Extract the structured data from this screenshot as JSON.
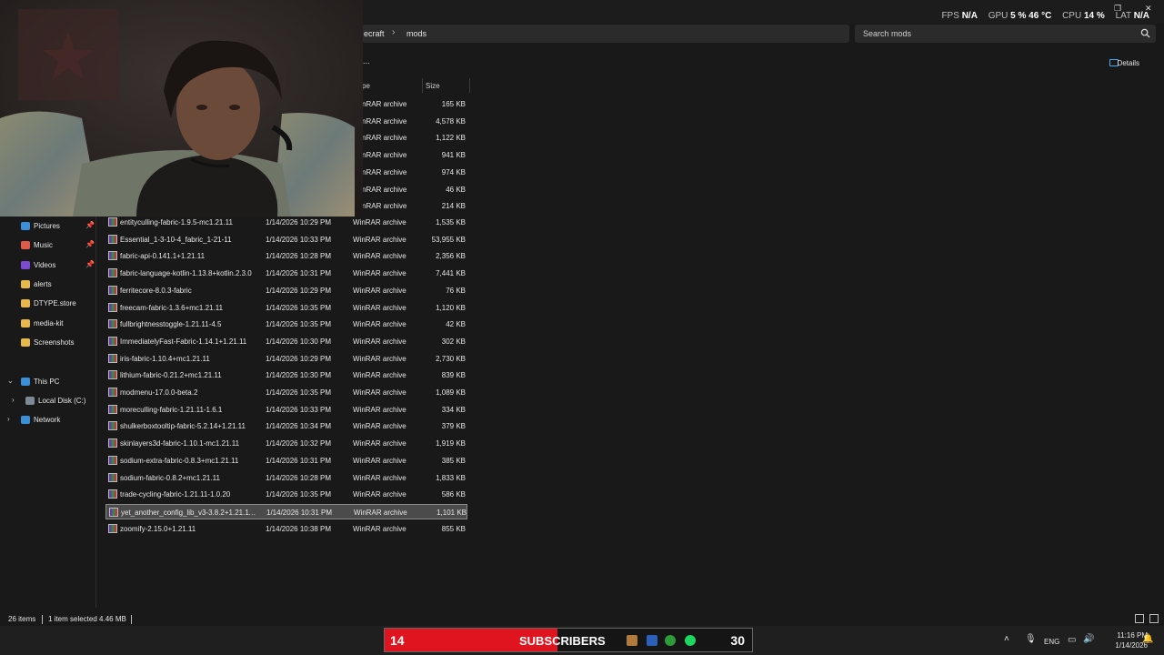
{
  "overlay": {
    "fps_label": "FPS",
    "fps_value": "N/A",
    "gpu_label": "GPU",
    "gpu_value": "5 %  46 °C",
    "cpu_label": "CPU",
    "cpu_value": "14 %",
    "lat_label": "LAT",
    "lat_value": "N/A"
  },
  "breadcrumb": {
    "parent": "ecraft",
    "current": "mods"
  },
  "search": {
    "placeholder": "Search mods"
  },
  "toolbar": {
    "details_label": "Details",
    "more_label": "..."
  },
  "columns": {
    "type": "pe",
    "size": "Size"
  },
  "nav": {
    "quick_access": [
      {
        "label": "Pictures",
        "icon": "pictures-icon",
        "color": "#3b8fd8",
        "pinned": true
      },
      {
        "label": "Music",
        "icon": "music-icon",
        "color": "#e05a4a",
        "pinned": true
      },
      {
        "label": "Videos",
        "icon": "videos-icon",
        "color": "#7a4bd0",
        "pinned": true
      },
      {
        "label": "alerts",
        "icon": "folder-icon",
        "color": "#e8b84a",
        "pinned": false
      },
      {
        "label": "DTYPE.store",
        "icon": "folder-icon",
        "color": "#e8b84a",
        "pinned": false
      },
      {
        "label": "media-kit",
        "icon": "folder-icon",
        "color": "#e8b84a",
        "pinned": false
      },
      {
        "label": "Screenshots",
        "icon": "folder-icon",
        "color": "#e8b84a",
        "pinned": false
      }
    ],
    "this_pc": "This PC",
    "local_disk": "Local Disk (C:)",
    "network": "Network"
  },
  "partial_rows": [
    {
      "type": "nRAR archive",
      "size": "165 KB"
    },
    {
      "type": "nRAR archive",
      "size": "4,578 KB"
    },
    {
      "type": "nRAR archive",
      "size": "1,122 KB"
    },
    {
      "type": "nRAR archive",
      "size": "941 KB"
    },
    {
      "type": "nRAR archive",
      "size": "974 KB"
    },
    {
      "type": "nRAR archive",
      "size": "46 KB"
    },
    {
      "type": "nRAR archive",
      "size": "214 KB"
    }
  ],
  "files": [
    {
      "name": "entityculling-fabric-1.9.5-mc1.21.11",
      "date": "1/14/2026 10:29 PM",
      "type": "WinRAR archive",
      "size": "1,535 KB"
    },
    {
      "name": "Essential_1-3-10-4_fabric_1-21-11",
      "date": "1/14/2026 10:33 PM",
      "type": "WinRAR archive",
      "size": "53,955 KB"
    },
    {
      "name": "fabric-api-0.141.1+1.21.11",
      "date": "1/14/2026 10:28 PM",
      "type": "WinRAR archive",
      "size": "2,356 KB"
    },
    {
      "name": "fabric-language-kotlin-1.13.8+kotlin.2.3.0",
      "date": "1/14/2026 10:31 PM",
      "type": "WinRAR archive",
      "size": "7,441 KB"
    },
    {
      "name": "ferritecore-8.0.3-fabric",
      "date": "1/14/2026 10:29 PM",
      "type": "WinRAR archive",
      "size": "76 KB"
    },
    {
      "name": "freecam-fabric-1.3.6+mc1.21.11",
      "date": "1/14/2026 10:35 PM",
      "type": "WinRAR archive",
      "size": "1,120 KB"
    },
    {
      "name": "fullbrightnesstoggle-1.21.11-4.5",
      "date": "1/14/2026 10:35 PM",
      "type": "WinRAR archive",
      "size": "42 KB"
    },
    {
      "name": "ImmediatelyFast-Fabric-1.14.1+1.21.11",
      "date": "1/14/2026 10:30 PM",
      "type": "WinRAR archive",
      "size": "302 KB"
    },
    {
      "name": "iris-fabric-1.10.4+mc1.21.11",
      "date": "1/14/2026 10:29 PM",
      "type": "WinRAR archive",
      "size": "2,730 KB"
    },
    {
      "name": "lithium-fabric-0.21.2+mc1.21.11",
      "date": "1/14/2026 10:30 PM",
      "type": "WinRAR archive",
      "size": "839 KB"
    },
    {
      "name": "modmenu-17.0.0-beta.2",
      "date": "1/14/2026 10:35 PM",
      "type": "WinRAR archive",
      "size": "1,089 KB"
    },
    {
      "name": "moreculling-fabric-1.21.11-1.6.1",
      "date": "1/14/2026 10:33 PM",
      "type": "WinRAR archive",
      "size": "334 KB"
    },
    {
      "name": "shulkerboxtooltip-fabric-5.2.14+1.21.11",
      "date": "1/14/2026 10:34 PM",
      "type": "WinRAR archive",
      "size": "379 KB"
    },
    {
      "name": "skinlayers3d-fabric-1.10.1-mc1.21.11",
      "date": "1/14/2026 10:32 PM",
      "type": "WinRAR archive",
      "size": "1,919 KB"
    },
    {
      "name": "sodium-extra-fabric-0.8.3+mc1.21.11",
      "date": "1/14/2026 10:31 PM",
      "type": "WinRAR archive",
      "size": "385 KB"
    },
    {
      "name": "sodium-fabric-0.8.2+mc1.21.11",
      "date": "1/14/2026 10:28 PM",
      "type": "WinRAR archive",
      "size": "1,833 KB"
    },
    {
      "name": "trade-cycling-fabric-1.21.11-1.0.20",
      "date": "1/14/2026 10:35 PM",
      "type": "WinRAR archive",
      "size": "586 KB"
    },
    {
      "name": "yet_another_config_lib_v3-3.8.2+1.21.11-...",
      "date": "1/14/2026 10:31 PM",
      "type": "WinRAR archive",
      "size": "1,101 KB",
      "selected": true
    },
    {
      "name": "zoomify-2.15.0+1.21.11",
      "date": "1/14/2026 10:38 PM",
      "type": "WinRAR archive",
      "size": "855 KB"
    }
  ],
  "status": {
    "items": "26 items",
    "selected": "1 item selected  4.46 MB"
  },
  "subscriber_widget": {
    "count": "14",
    "label": "SUBSCRIBERS",
    "goal": "30",
    "progress": 0.47
  },
  "tray": {
    "language": "ENG",
    "time": "11:16 PM",
    "date": "1/14/2026"
  },
  "colors": {
    "accent": "#4aa8f0",
    "subscriber_bar": "#e0141e",
    "selection": "#4b4b4b"
  }
}
